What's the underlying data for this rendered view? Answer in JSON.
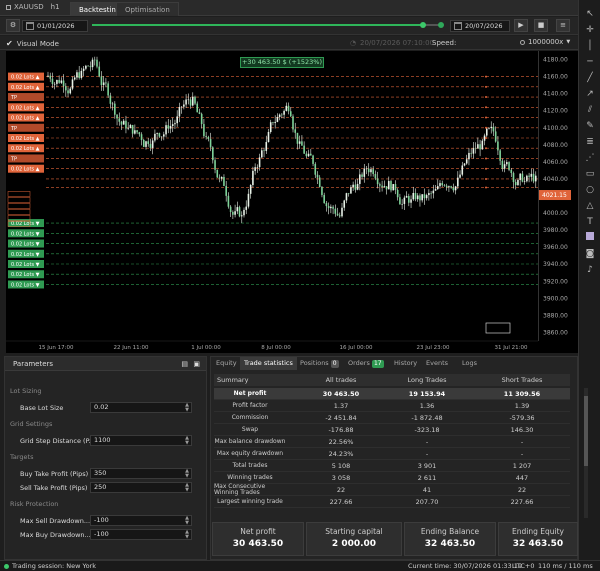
{
  "app": {
    "symbol": "XAUUSD",
    "timeframe": "h1",
    "tabs": [
      {
        "label": "Backtesting",
        "active": true
      },
      {
        "label": "Optimisation",
        "active": false
      }
    ]
  },
  "controls": {
    "start_date": "01/01/2026",
    "end_date": "20/07/2026",
    "progress_fraction": 0.94,
    "speed_label": "Speed:",
    "speed_value": "1000000x",
    "faded_timestamp": "20/07/2026 07:10:00"
  },
  "visual_mode": {
    "label": "Visual Mode",
    "checked": true
  },
  "chart": {
    "pl_label": "+30 463.50 $ (+1523%)",
    "current_price": "4021.15",
    "price_ticks": [
      "4180.00",
      "4160.00",
      "4140.00",
      "4120.00",
      "4100.00",
      "4080.00",
      "4060.00",
      "4040.00",
      "4020.00",
      "4000.00",
      "3980.00",
      "3960.00",
      "3940.00",
      "3920.00",
      "3900.00",
      "3880.00",
      "3860.00"
    ],
    "time_ticks": [
      "15 Jun 17:00",
      "22 Jun 11:00",
      "1 Jul 00:00",
      "8 Jul 00:00",
      "16 Jul 00:00",
      "23 Jul 23:00",
      "31 Jul 21:00"
    ],
    "sell_label": "0.02 Lots",
    "tp_label": "TP",
    "buy_label": "0.02 Lots"
  },
  "colors": {
    "sell": "#e0643a",
    "buy": "#2f9a52",
    "accent_green": "#3cc86a",
    "candle": "#e8f2e8"
  },
  "parameters": {
    "title": "Parameters",
    "sections": [
      {
        "title": "Lot Sizing",
        "rows": [
          {
            "label": "Base Lot Size",
            "value": "0.02"
          }
        ]
      },
      {
        "title": "Grid Settings",
        "rows": [
          {
            "label": "Grid Step Distance (P...",
            "value": "1100"
          }
        ]
      },
      {
        "title": "Targets",
        "rows": [
          {
            "label": "Buy Take Profit (Pips)",
            "value": "350"
          },
          {
            "label": "Sell Take Profit (Pips)",
            "value": "250"
          }
        ]
      },
      {
        "title": "Risk Protection",
        "rows": [
          {
            "label": "Max Sell Drawdown...",
            "value": "-100"
          },
          {
            "label": "Max Buy Drawdown...",
            "value": "-100"
          }
        ]
      }
    ]
  },
  "results_tabs": [
    {
      "label": "Equity",
      "active": false
    },
    {
      "label": "Trade statistics",
      "active": true
    },
    {
      "label": "Positions",
      "active": false,
      "badge": "0"
    },
    {
      "label": "Orders",
      "active": false,
      "badge": "17"
    },
    {
      "label": "History",
      "active": false
    },
    {
      "label": "Events",
      "active": false
    },
    {
      "label": "Logs",
      "active": false
    }
  ],
  "stats": {
    "headers": [
      "Summary",
      "All trades",
      "Long Trades",
      "Short Trades"
    ],
    "rows": [
      [
        "Net profit",
        "30 463.50",
        "19 153.94",
        "11 309.56"
      ],
      [
        "Profit factor",
        "1.37",
        "1.36",
        "1.39"
      ],
      [
        "Commission",
        "-2 451.84",
        "-1 872.48",
        "-579.36"
      ],
      [
        "Swap",
        "-176.88",
        "-323.18",
        "146.30"
      ],
      [
        "Max balance drawdown",
        "22.56%",
        "-",
        "-"
      ],
      [
        "Max equity drawdown",
        "24.23%",
        "-",
        "-"
      ],
      [
        "Total trades",
        "5 108",
        "3 901",
        "1 207"
      ],
      [
        "Winning trades",
        "3 058",
        "2 611",
        "447"
      ],
      [
        "Max Consecutive Winning Trades",
        "22",
        "41",
        "22"
      ],
      [
        "Largest winning trade",
        "227.66",
        "207.70",
        "227.66"
      ]
    ]
  },
  "summary": [
    {
      "label": "Net profit",
      "value": "30 463.50"
    },
    {
      "label": "Starting capital",
      "value": "2 000.00"
    },
    {
      "label": "Ending Balance",
      "value": "32 463.50"
    },
    {
      "label": "Ending Equity",
      "value": "32 463.50"
    }
  ],
  "status": {
    "session": "Trading session: New York",
    "current_time": "Current time: 30/07/2026 01:33:19",
    "timezone": "UTC+0",
    "latency": "110 ms / 110 ms"
  }
}
